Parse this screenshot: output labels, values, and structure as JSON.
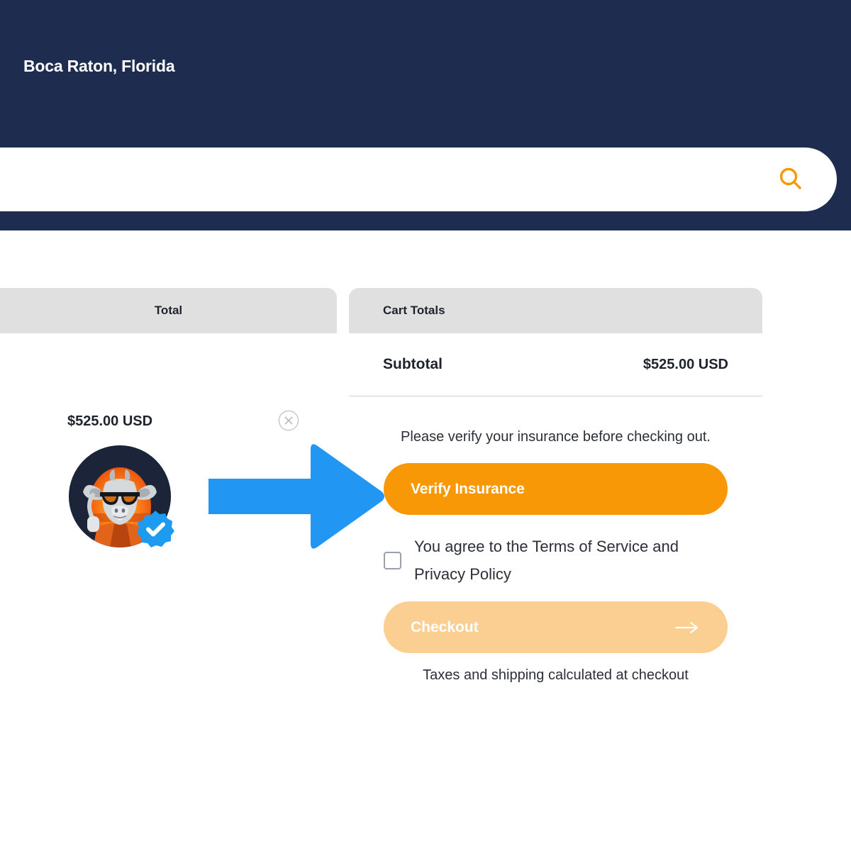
{
  "header": {
    "location_title": "Boca Raton, Florida",
    "bg_color": "#1e2d4f"
  },
  "search": {
    "value": "",
    "placeholder": "",
    "icon": "search-icon",
    "icon_color": "#F99806"
  },
  "cart": {
    "left_panel": {
      "column_header": "Total",
      "item_price": "$525.00 USD",
      "remove_icon": "close-circle-icon",
      "avatar": {
        "icon": "goat-avatar-image",
        "verified_badge": "verified-check-icon",
        "badge_color": "#1D9BF0"
      }
    },
    "totals_panel": {
      "header": "Cart Totals",
      "subtotal_label": "Subtotal",
      "subtotal_value": "$525.00 USD",
      "insurance_note": "Please verify your insurance before checking out.",
      "verify_button": "Verify Insurance",
      "verify_button_color": "#F99806",
      "terms_text": "You agree to the Terms of Service and Privacy Policy",
      "terms_checked": false,
      "checkout_button": "Checkout",
      "checkout_button_color": "#FBCE91",
      "checkout_arrow_icon": "arrow-right-icon",
      "checkout_note": "Taxes and shipping calculated at checkout"
    }
  },
  "annotation": {
    "arrow_icon": "pointer-arrow-right",
    "arrow_color": "#2196F3"
  }
}
